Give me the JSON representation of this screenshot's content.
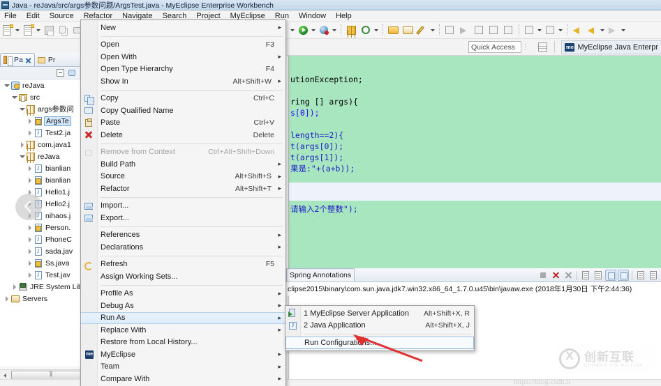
{
  "window": {
    "title": "Java - reJava/src/args参数问题/ArgsTest.java - MyEclipse Enterprise Workbench",
    "icon": "eclipse-icon"
  },
  "menubar": {
    "items": [
      "File",
      "Edit",
      "Source",
      "Refactor",
      "Navigate",
      "Search",
      "Project",
      "MyEclipse",
      "Run",
      "Window",
      "Help"
    ]
  },
  "quick_access": {
    "placeholder": "Quick Access",
    "value": "Quick Access",
    "perspective_label": "MyEclipse Java Enterpr"
  },
  "explorer": {
    "tabs": [
      {
        "label": "Pa",
        "active": true,
        "icon": "package-explorer-icon"
      },
      {
        "label": "Pr",
        "active": false,
        "icon": "project-explorer-icon"
      }
    ],
    "tree": [
      {
        "label": "reJava",
        "indent": 0,
        "twist": "open",
        "icon": "java-project-icon",
        "selected": false
      },
      {
        "label": "src",
        "indent": 1,
        "twist": "open",
        "icon": "source-folder-icon",
        "selected": false
      },
      {
        "label": "args参数问",
        "indent": 2,
        "twist": "open",
        "icon": "package-icon",
        "selected": false
      },
      {
        "label": "ArgsTe",
        "indent": 3,
        "twist": "closed",
        "icon": "java-file-lock-icon",
        "selected": true
      },
      {
        "label": "Test2.ja",
        "indent": 3,
        "twist": "closed",
        "icon": "java-file-icon",
        "selected": false
      },
      {
        "label": "com.java1",
        "indent": 2,
        "twist": "closed",
        "icon": "package-icon",
        "selected": false
      },
      {
        "label": "reJava",
        "indent": 2,
        "twist": "open",
        "icon": "package-icon",
        "selected": false
      },
      {
        "label": "bianlian",
        "indent": 3,
        "twist": "closed",
        "icon": "java-file-icon",
        "selected": false
      },
      {
        "label": "bianlian",
        "indent": 3,
        "twist": "closed",
        "icon": "java-file-lock-icon",
        "selected": false
      },
      {
        "label": "Hello1.j",
        "indent": 3,
        "twist": "closed",
        "icon": "java-file-icon",
        "selected": false
      },
      {
        "label": "Hello2.j",
        "indent": 3,
        "twist": "closed",
        "icon": "java-file-icon",
        "selected": false
      },
      {
        "label": "nihaos.j",
        "indent": 3,
        "twist": "closed",
        "icon": "java-file-icon",
        "selected": false
      },
      {
        "label": "Person.",
        "indent": 3,
        "twist": "closed",
        "icon": "java-file-lock-icon",
        "selected": false
      },
      {
        "label": "PhoneC",
        "indent": 3,
        "twist": "closed",
        "icon": "java-file-icon",
        "selected": false
      },
      {
        "label": "sada.jav",
        "indent": 3,
        "twist": "closed",
        "icon": "java-file-icon",
        "selected": false
      },
      {
        "label": "Ss.java",
        "indent": 3,
        "twist": "closed",
        "icon": "java-file-lock-icon",
        "selected": false
      },
      {
        "label": "Test.jav",
        "indent": 3,
        "twist": "closed",
        "icon": "java-file-icon",
        "selected": false
      },
      {
        "label": "JRE System Lib",
        "indent": 1,
        "twist": "closed",
        "icon": "jre-library-icon",
        "selected": false
      },
      {
        "label": "Servers",
        "indent": 0,
        "twist": "closed",
        "icon": "servers-folder-icon",
        "selected": false
      }
    ]
  },
  "context_menu": {
    "items": [
      {
        "label": "New",
        "accel": "",
        "submenu": true,
        "icon": "",
        "disabled": false,
        "highlight": false
      },
      {
        "sep": true
      },
      {
        "label": "Open",
        "accel": "F3",
        "submenu": false,
        "icon": "",
        "disabled": false,
        "highlight": false
      },
      {
        "label": "Open With",
        "accel": "",
        "submenu": true,
        "icon": "",
        "disabled": false,
        "highlight": false
      },
      {
        "label": "Open Type Hierarchy",
        "accel": "F4",
        "submenu": false,
        "icon": "",
        "disabled": false,
        "highlight": false
      },
      {
        "label": "Show In",
        "accel": "Alt+Shift+W",
        "submenu": true,
        "icon": "",
        "disabled": false,
        "highlight": false
      },
      {
        "sep": true
      },
      {
        "label": "Copy",
        "accel": "Ctrl+C",
        "submenu": false,
        "icon": "copy-icon",
        "disabled": false,
        "highlight": false
      },
      {
        "label": "Copy Qualified Name",
        "accel": "",
        "submenu": false,
        "icon": "copy-qualified-name-icon",
        "disabled": false,
        "highlight": false
      },
      {
        "label": "Paste",
        "accel": "Ctrl+V",
        "submenu": false,
        "icon": "paste-icon",
        "disabled": false,
        "highlight": false
      },
      {
        "label": "Delete",
        "accel": "Delete",
        "submenu": false,
        "icon": "delete-icon",
        "disabled": false,
        "highlight": false
      },
      {
        "sep": true
      },
      {
        "label": "Remove from Context",
        "accel": "Ctrl+Alt+Shift+Down",
        "submenu": false,
        "icon": "remove-from-context-icon",
        "disabled": true,
        "highlight": false
      },
      {
        "label": "Build Path",
        "accel": "",
        "submenu": true,
        "icon": "",
        "disabled": false,
        "highlight": false
      },
      {
        "label": "Source",
        "accel": "Alt+Shift+S",
        "submenu": true,
        "icon": "",
        "disabled": false,
        "highlight": false
      },
      {
        "label": "Refactor",
        "accel": "Alt+Shift+T",
        "submenu": true,
        "icon": "",
        "disabled": false,
        "highlight": false
      },
      {
        "sep": true
      },
      {
        "label": "Import...",
        "accel": "",
        "submenu": false,
        "icon": "import-icon",
        "disabled": false,
        "highlight": false
      },
      {
        "label": "Export...",
        "accel": "",
        "submenu": false,
        "icon": "export-icon",
        "disabled": false,
        "highlight": false
      },
      {
        "sep": true
      },
      {
        "label": "References",
        "accel": "",
        "submenu": true,
        "icon": "",
        "disabled": false,
        "highlight": false
      },
      {
        "label": "Declarations",
        "accel": "",
        "submenu": true,
        "icon": "",
        "disabled": false,
        "highlight": false
      },
      {
        "sep": true
      },
      {
        "label": "Refresh",
        "accel": "F5",
        "submenu": false,
        "icon": "refresh-icon",
        "disabled": false,
        "highlight": false
      },
      {
        "label": "Assign Working Sets...",
        "accel": "",
        "submenu": false,
        "icon": "",
        "disabled": false,
        "highlight": false
      },
      {
        "sep": true
      },
      {
        "label": "Profile As",
        "accel": "",
        "submenu": true,
        "icon": "",
        "disabled": false,
        "highlight": false
      },
      {
        "label": "Debug As",
        "accel": "",
        "submenu": true,
        "icon": "",
        "disabled": false,
        "highlight": false
      },
      {
        "label": "Run As",
        "accel": "",
        "submenu": true,
        "icon": "",
        "disabled": false,
        "highlight": true
      },
      {
        "label": "Replace With",
        "accel": "",
        "submenu": true,
        "icon": "",
        "disabled": false,
        "highlight": false
      },
      {
        "label": "Restore from Local History...",
        "accel": "",
        "submenu": false,
        "icon": "",
        "disabled": false,
        "highlight": false
      },
      {
        "label": "MyEclipse",
        "accel": "",
        "submenu": true,
        "icon": "myeclipse-icon",
        "disabled": false,
        "highlight": false
      },
      {
        "label": "Team",
        "accel": "",
        "submenu": true,
        "icon": "",
        "disabled": false,
        "highlight": false
      },
      {
        "label": "Compare With",
        "accel": "",
        "submenu": true,
        "icon": "",
        "disabled": false,
        "highlight": false
      }
    ]
  },
  "run_as_submenu": {
    "items": [
      {
        "label": "1 MyEclipse Server Application",
        "accel": "Alt+Shift+X, R",
        "icon": "server-app-icon",
        "outlined": false
      },
      {
        "label": "2 Java Application",
        "accel": "Alt+Shift+X, J",
        "icon": "java-app-icon",
        "outlined": false
      },
      {
        "sep": true
      },
      {
        "label": "Run Configurations...",
        "accel": "",
        "icon": "",
        "outlined": true
      }
    ]
  },
  "editor": {
    "background_color": "#a8e6c0",
    "lines": [
      "utionException;",
      "",
      "ring [] args){",
      "s[0]);",
      "",
      "length==2){",
      "t(args[0]);",
      "t(args[1]);",
      "果是:\"+(a+b));"
    ],
    "line_after_band": "请输入2个整数\");"
  },
  "console": {
    "tabs": [
      {
        "label": "Spring Annotations",
        "active": true
      }
    ],
    "output_line": "clipse2015\\binary\\com.sun.java.jdk7.win32.x86_64_1.7.0.u45\\bin\\javaw.exe (2018年1月30日 下午2:44:36)",
    "toolbar_icons": [
      "terminate-stop-icon",
      "terminate-icon",
      "remove-all-terminated-icon",
      "clear-console-icon",
      "display-selected-console-icon",
      "scroll-lock-icon",
      "word-wrap-icon",
      "pin-console-icon",
      "new-console-view-icon"
    ]
  },
  "watermark": {
    "main_text": "创新互联",
    "sub_text": "CHUANG XIN HU LIAN",
    "logo": "cx-logo-icon"
  },
  "bottom_url": "https://blog.csdn.n",
  "toolbar": {
    "icons": [
      "new-wizard-icon",
      "new-dropdown-arrow",
      "new-java-class-icon",
      "new-java-dropdown-arrow",
      "save-icon",
      "save-all-icon",
      "print-icon",
      "build-icon",
      "build-dropdown-arrow",
      "run-icon",
      "run-dropdown-arrow",
      "debug-icon",
      "debug-dropdown-arrow",
      "deploy-icon",
      "run-server-icon",
      "server-dropdown-arrow",
      "open-folder-icon",
      "open-resource-icon",
      "edit-icon",
      "edit-dropdown-arrow",
      "search-icon",
      "skip-breakpoints-icon",
      "next-annotation-icon",
      "toggle-block-icon",
      "toggle-mark-icon",
      "previous-edit-icon",
      "previous-dropdown-arrow",
      "next-edit-icon",
      "next-dropdown-arrow",
      "back-icon",
      "forward-icon",
      "forward-dropdown-arrow",
      "go-icon",
      "go-dropdown-arrow"
    ]
  }
}
